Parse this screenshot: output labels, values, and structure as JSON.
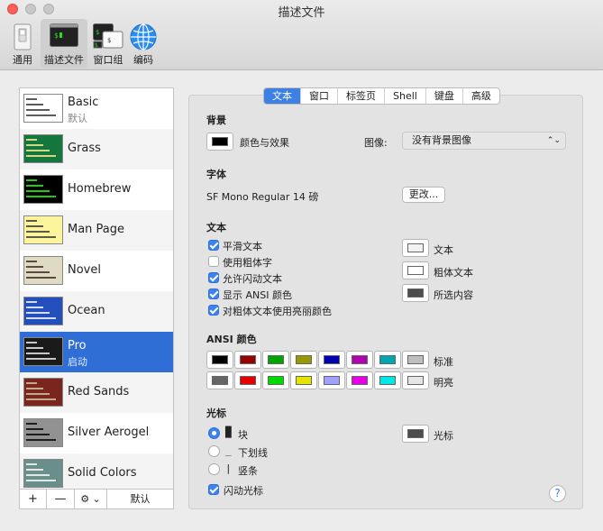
{
  "window": {
    "title": "描述文件"
  },
  "toolbar": {
    "items": [
      {
        "label": "通用",
        "icon": "switch-icon"
      },
      {
        "label": "描述文件",
        "icon": "terminal-icon"
      },
      {
        "label": "窗口组",
        "icon": "window-group-icon"
      },
      {
        "label": "编码",
        "icon": "globe-icon"
      }
    ]
  },
  "sidebar": {
    "profiles": [
      {
        "name": "Basic",
        "sub": "默认",
        "bg": "#ffffff",
        "accent": "#333333"
      },
      {
        "name": "Grass",
        "sub": "",
        "bg": "#13773d",
        "accent": "#ffef99"
      },
      {
        "name": "Homebrew",
        "sub": "",
        "bg": "#000000",
        "accent": "#28fe14"
      },
      {
        "name": "Man Page",
        "sub": "",
        "bg": "#fef49c",
        "accent": "#333333"
      },
      {
        "name": "Novel",
        "sub": "",
        "bg": "#dfdbc3",
        "accent": "#3b2322"
      },
      {
        "name": "Ocean",
        "sub": "",
        "bg": "#224fbc",
        "accent": "#ffffff"
      },
      {
        "name": "Pro",
        "sub": "启动",
        "bg": "#1a1a1a",
        "accent": "#f2f2f2"
      },
      {
        "name": "Red Sands",
        "sub": "",
        "bg": "#7a251e",
        "accent": "#d7c9a7"
      },
      {
        "name": "Silver Aerogel",
        "sub": "",
        "bg": "#929292",
        "accent": "#000000"
      },
      {
        "name": "Solid Colors",
        "sub": "",
        "bg": "#6a8e8a",
        "accent": "#ffffff"
      }
    ],
    "footer": {
      "add": "+",
      "remove": "—",
      "gear": "⚙ ⌄",
      "default": "默认"
    }
  },
  "tabs": [
    "文本",
    "窗口",
    "标签页",
    "Shell",
    "键盘",
    "高级"
  ],
  "background": {
    "heading": "背景",
    "color_effects": "颜色与效果",
    "image_label": "图像:",
    "image_value": "没有背景图像",
    "color": "#000000"
  },
  "font": {
    "heading": "字体",
    "value": "SF Mono Regular 14 磅",
    "change": "更改..."
  },
  "text": {
    "heading": "文本",
    "options": [
      {
        "label": "平滑文本",
        "checked": true
      },
      {
        "label": "使用粗体字",
        "checked": false
      },
      {
        "label": "允许闪动文本",
        "checked": true
      },
      {
        "label": "显示 ANSI 颜色",
        "checked": true
      },
      {
        "label": "对粗体文本使用亮丽颜色",
        "checked": true
      }
    ],
    "colors": [
      {
        "label": "文本",
        "color": "#f2f2f2"
      },
      {
        "label": "粗体文本",
        "color": "#ffffff"
      },
      {
        "label": "所选内容",
        "color": "#4d4d4d"
      }
    ]
  },
  "ansi": {
    "heading": "ANSI 颜色",
    "standard_label": "标准",
    "bright_label": "明亮",
    "standard": [
      "#000000",
      "#990000",
      "#00a600",
      "#999900",
      "#0000b2",
      "#b200b2",
      "#00a6b2",
      "#bfbfbf"
    ],
    "bright": [
      "#666666",
      "#e50000",
      "#00d900",
      "#e5e500",
      "#a0a0ff",
      "#e500e5",
      "#00e5e5",
      "#e5e5e5"
    ]
  },
  "cursor": {
    "heading": "光标",
    "options": [
      {
        "glyph": "█",
        "label": "块",
        "selected": true
      },
      {
        "glyph": "_",
        "label": "下划线",
        "selected": false
      },
      {
        "glyph": "|",
        "label": "竖条",
        "selected": false
      }
    ],
    "blink_label": "闪动光标",
    "blink": true,
    "color_label": "光标",
    "color": "#4d4d4d"
  },
  "help": "?"
}
